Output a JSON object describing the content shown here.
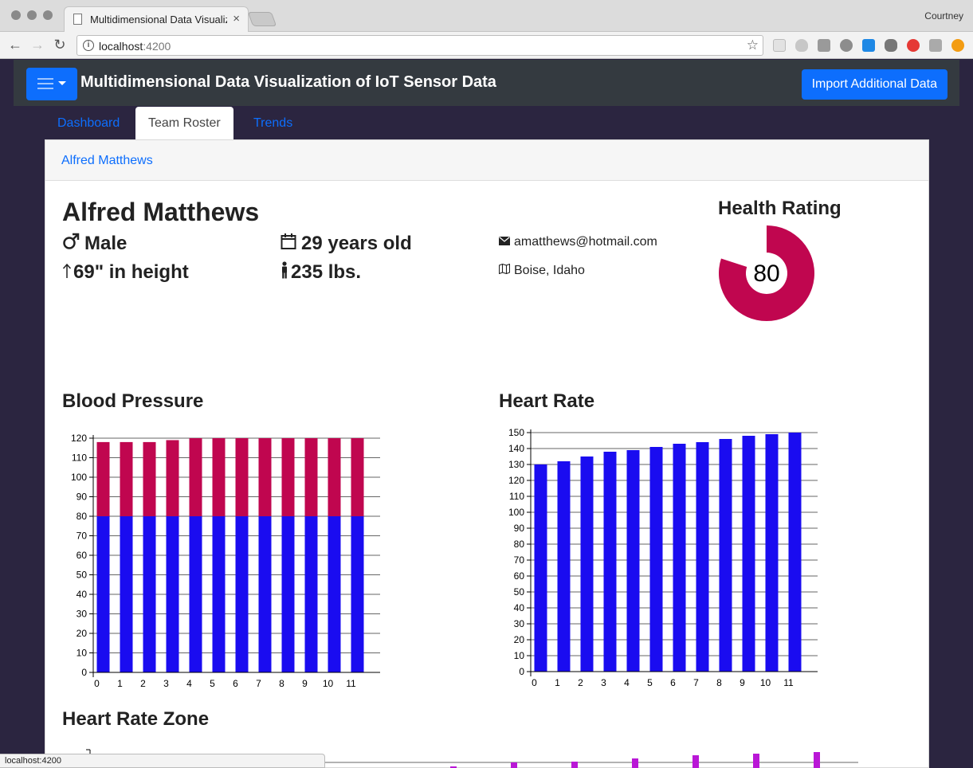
{
  "browser": {
    "tab_title": "Multidimensional Data Visualiz",
    "profile_name": "Courtney",
    "url_host": "localhost",
    "url_port": ":4200",
    "status_url": "localhost:4200"
  },
  "app": {
    "title": "Multidimensional Data Visualization of IoT Sensor Data",
    "import_label": "Import Additional Data",
    "tabs": [
      {
        "label": "Dashboard",
        "active": false
      },
      {
        "label": "Team Roster",
        "active": true
      },
      {
        "label": "Trends",
        "active": false
      }
    ],
    "breadcrumb": "Alfred Matthews"
  },
  "profile": {
    "name": "Alfred Matthews",
    "gender": "Male",
    "age": "29 years old",
    "height": "69\" in height",
    "weight": "235 lbs.",
    "email": "amatthews@hotmail.com",
    "location": "Boise, Idaho",
    "health_title": "Health Rating",
    "health_value": "80",
    "health_fraction": 0.8
  },
  "colors": {
    "accent": "#0d6efd",
    "blue_bar": "#1a0cf0",
    "red_bar": "#c0064f",
    "magenta": "#b917d6"
  },
  "blood_pressure_title": "Blood Pressure",
  "heart_rate_title": "Heart Rate",
  "heart_rate_zone_title": "Heart Rate Zone",
  "chart_data": [
    {
      "type": "bar",
      "title": "Blood Pressure",
      "categories": [
        "0",
        "1",
        "2",
        "3",
        "4",
        "5",
        "6",
        "7",
        "8",
        "9",
        "10",
        "11"
      ],
      "stacked": true,
      "series": [
        {
          "values": [
            80,
            80,
            80,
            80,
            80,
            80,
            80,
            80,
            80,
            80,
            80,
            80
          ]
        },
        {
          "values": [
            118,
            118,
            118,
            119,
            120,
            120,
            121,
            121,
            122,
            122,
            123,
            123
          ]
        }
      ],
      "ylim": [
        0,
        120
      ],
      "yticks": [
        0,
        10,
        20,
        30,
        40,
        50,
        60,
        70,
        80,
        90,
        100,
        110,
        120
      ],
      "grid": true
    },
    {
      "type": "bar",
      "title": "Heart Rate",
      "categories": [
        "0",
        "1",
        "2",
        "3",
        "4",
        "5",
        "6",
        "7",
        "8",
        "9",
        "10",
        "11"
      ],
      "series": [
        {
          "values": [
            130,
            132,
            135,
            138,
            139,
            141,
            143,
            144,
            146,
            148,
            149,
            150
          ]
        }
      ],
      "ylim": [
        0,
        150
      ],
      "yticks": [
        0,
        10,
        20,
        30,
        40,
        50,
        60,
        70,
        80,
        90,
        100,
        110,
        120,
        130,
        140,
        150
      ],
      "grid": true
    }
  ]
}
